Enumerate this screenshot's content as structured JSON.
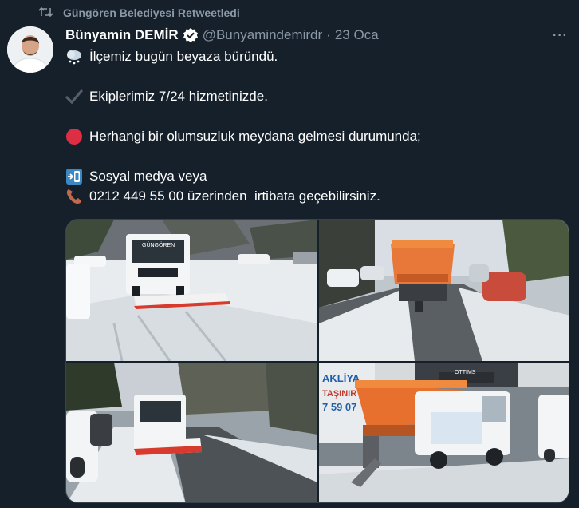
{
  "retweet": {
    "icon": "retweet-icon",
    "label": "Güngören Belediyesi Retweetledi"
  },
  "tweet": {
    "author_name": "Bünyamin DEMİR",
    "verified_icon": "verified-badge-icon",
    "handle": "@Bunyamindemirdr",
    "separator": "·",
    "date": "23 Oca",
    "more_icon": "more-icon",
    "more_label": "···",
    "lines": {
      "l1": "İlçemiz bugün beyaza büründü.",
      "l2": "Ekiplerimiz 7/24 hizmetinizde.",
      "l3": "Herhangi bir olumsuzluk meydana gelmesi durumunda;",
      "l4": "Sosyal medya veya",
      "l5": "0212 449 55 00 üzerinden  irtibata geçebilirsiniz."
    },
    "emoji": {
      "l1": "snow-cloud-icon",
      "l2": "check-mark-icon",
      "l3": "red-circle-icon",
      "l4": "mobile-arrow-icon",
      "l5": "telephone-icon"
    }
  },
  "media": {
    "photos": [
      {
        "name": "snowplow-front-photo",
        "truck_sign": "GÜNGÖREN"
      },
      {
        "name": "salt-spreader-rear-photo"
      },
      {
        "name": "snowplow-road-photo"
      },
      {
        "name": "salt-truck-street-photo",
        "sign_left_1": "AKLİYA",
        "sign_left_2": "TAŞINIR",
        "sign_left_3": "7 59 07",
        "shop_sign": "OTTIMS"
      }
    ]
  },
  "colors": {
    "background": "#15202b",
    "text": "#ffffff",
    "secondary_text": "#8b98a5",
    "verified": "#ffffff",
    "border": "#38444d"
  }
}
